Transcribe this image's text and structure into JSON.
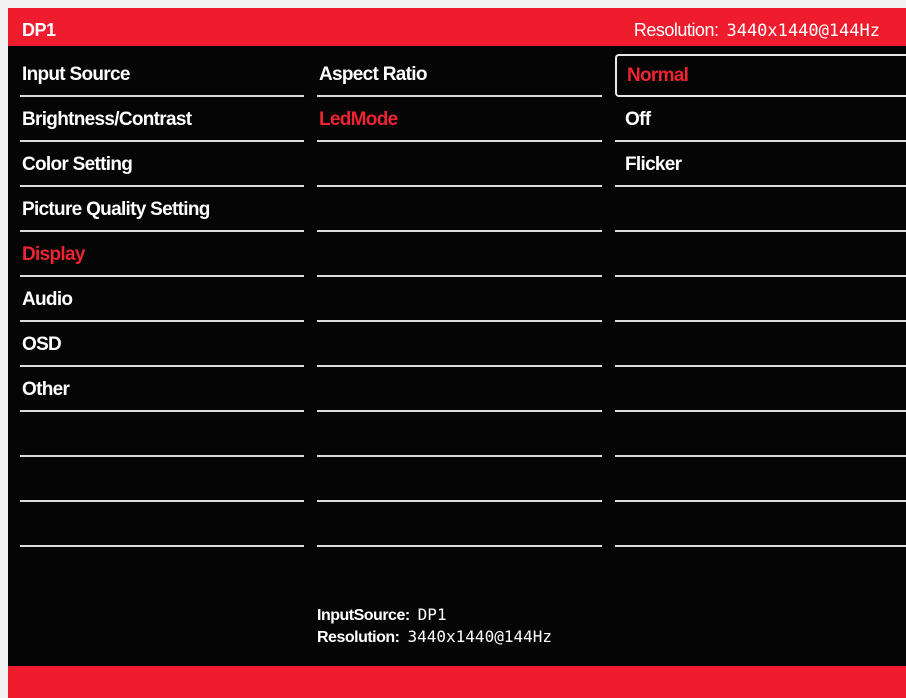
{
  "header": {
    "input_label": "DP1",
    "resolution_label": "Resolution:",
    "resolution_value": "3440x1440@144Hz"
  },
  "menu": {
    "items": [
      {
        "label": "Input Source",
        "highlighted": false
      },
      {
        "label": "Brightness/Contrast",
        "highlighted": false
      },
      {
        "label": "Color Setting",
        "highlighted": false
      },
      {
        "label": "Picture Quality Setting",
        "highlighted": false
      },
      {
        "label": "Display",
        "highlighted": true
      },
      {
        "label": "Audio",
        "highlighted": false
      },
      {
        "label": "OSD",
        "highlighted": false
      },
      {
        "label": "Other",
        "highlighted": false
      },
      {
        "label": "",
        "highlighted": false
      },
      {
        "label": "",
        "highlighted": false
      },
      {
        "label": "",
        "highlighted": false
      }
    ]
  },
  "submenu": {
    "items": [
      {
        "label": "Aspect Ratio",
        "highlighted": false
      },
      {
        "label": "LedMode",
        "highlighted": true
      },
      {
        "label": "",
        "highlighted": false
      },
      {
        "label": "",
        "highlighted": false
      },
      {
        "label": "",
        "highlighted": false
      },
      {
        "label": "",
        "highlighted": false
      },
      {
        "label": "",
        "highlighted": false
      },
      {
        "label": "",
        "highlighted": false
      },
      {
        "label": "",
        "highlighted": false
      },
      {
        "label": "",
        "highlighted": false
      },
      {
        "label": "",
        "highlighted": false
      }
    ]
  },
  "options": {
    "items": [
      {
        "label": "Normal",
        "selected": true
      },
      {
        "label": "Off",
        "selected": false
      },
      {
        "label": "Flicker",
        "selected": false
      },
      {
        "label": "",
        "selected": false
      },
      {
        "label": "",
        "selected": false
      },
      {
        "label": "",
        "selected": false
      },
      {
        "label": "",
        "selected": false
      },
      {
        "label": "",
        "selected": false
      },
      {
        "label": "",
        "selected": false
      },
      {
        "label": "",
        "selected": false
      },
      {
        "label": "",
        "selected": false
      }
    ]
  },
  "footer_info": {
    "input_source_label": "InputSource:",
    "input_source_value": "DP1",
    "resolution_label": "Resolution:",
    "resolution_value": "3440x1440@144Hz"
  },
  "colors": {
    "accent_red": "#ef1c2e",
    "highlight_text_red": "#ee2433",
    "background": "#050505",
    "text": "#ffffff"
  }
}
